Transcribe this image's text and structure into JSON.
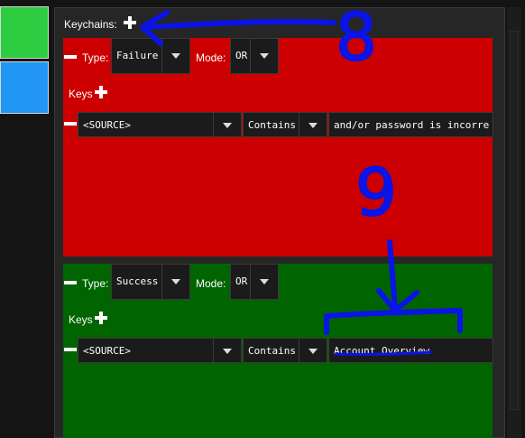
{
  "colors": {
    "failure_bg": "#cc0000",
    "success_bg": "#006400",
    "swatch_green": "#2ecc40",
    "swatch_blue": "#2196f3",
    "annotation": "#0a14e6"
  },
  "header": {
    "keychains_label": "Keychains:"
  },
  "keychains": [
    {
      "type_label": "Type:",
      "type_value": "Failure",
      "mode_label": "Mode:",
      "mode_value": "OR",
      "keys_label": "Keys",
      "keys": [
        {
          "source": "<SOURCE>",
          "condition": "Contains",
          "value": "and/or password is incorre"
        }
      ]
    },
    {
      "type_label": "Type:",
      "type_value": "Success",
      "mode_label": "Mode:",
      "mode_value": "OR",
      "keys_label": "Keys",
      "keys": [
        {
          "source": "<SOURCE>",
          "condition": "Contains",
          "value": "Account Overview"
        }
      ]
    }
  ],
  "annotations": {
    "label_8": "8",
    "label_9": "9"
  }
}
